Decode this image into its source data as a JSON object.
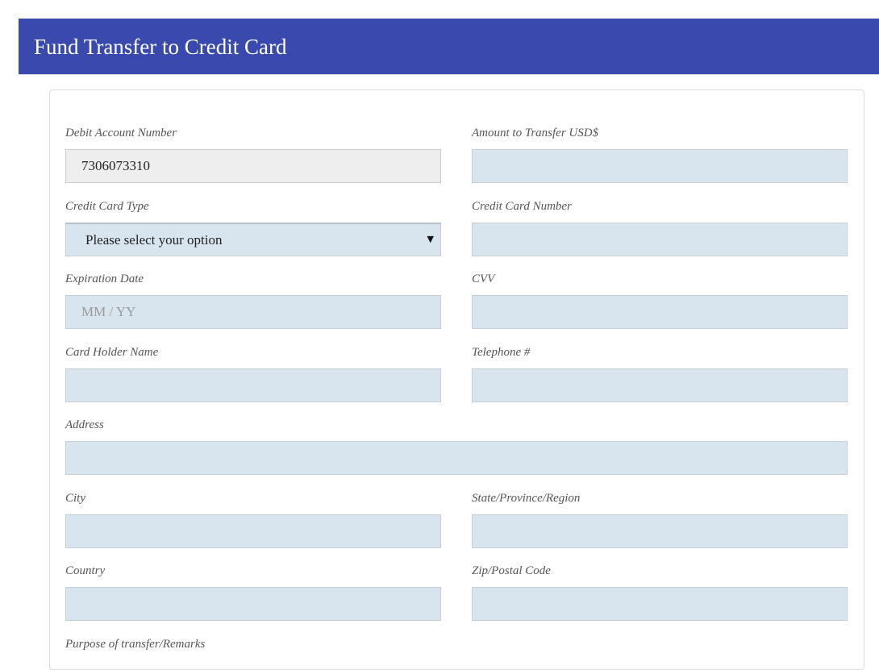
{
  "header": {
    "title": "Fund Transfer to Credit Card"
  },
  "form": {
    "debit_account": {
      "label": "Debit Account Number",
      "value": "7306073310"
    },
    "amount": {
      "label": "Amount to Transfer USD$",
      "value": ""
    },
    "card_type": {
      "label": "Credit Card Type",
      "selected": "Please select your option",
      "icon": "chevron-down-icon"
    },
    "card_number": {
      "label": "Credit Card Number",
      "value": ""
    },
    "expiration": {
      "label": "Expiration Date",
      "placeholder": "MM / YY"
    },
    "cvv": {
      "label": "CVV",
      "value": ""
    },
    "holder_name": {
      "label": "Card Holder Name",
      "value": ""
    },
    "telephone": {
      "label": "Telephone #",
      "value": ""
    },
    "address": {
      "label": "Address",
      "value": ""
    },
    "city": {
      "label": "City",
      "value": ""
    },
    "state": {
      "label": "State/Province/Region",
      "value": ""
    },
    "country": {
      "label": "Country",
      "value": ""
    },
    "zip": {
      "label": "Zip/Postal Code",
      "value": ""
    },
    "purpose": {
      "label": "Purpose of transfer/Remarks"
    }
  },
  "colors": {
    "header_bg": "#3a49ad",
    "input_bg": "#d8e5ef",
    "readonly_bg": "#eeeeee"
  }
}
